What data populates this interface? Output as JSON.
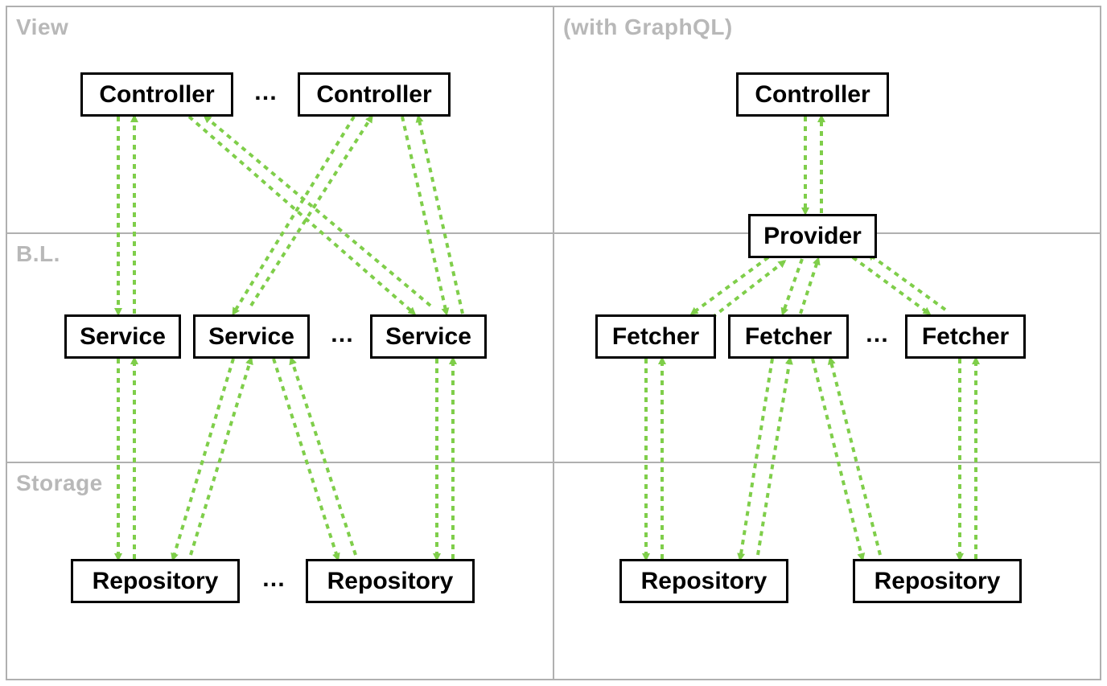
{
  "rows": {
    "view": "View",
    "bl": "B.L.",
    "storage": "Storage",
    "graphql": "(with GraphQL)"
  },
  "left": {
    "controller1": "Controller",
    "controller2": "Controller",
    "controller_ellipsis": "…",
    "service1": "Service",
    "service2": "Service",
    "service3": "Service",
    "service_ellipsis": "…",
    "repo1": "Repository",
    "repo2": "Repository",
    "repo_ellipsis": "…"
  },
  "right": {
    "controller": "Controller",
    "provider": "Provider",
    "fetcher1": "Fetcher",
    "fetcher2": "Fetcher",
    "fetcher3": "Fetcher",
    "fetcher_ellipsis": "…",
    "repo1": "Repository",
    "repo2": "Repository"
  },
  "colors": {
    "arrow": "#7fce4a",
    "grid": "#b0b0b0",
    "label": "#b8b8b8"
  }
}
